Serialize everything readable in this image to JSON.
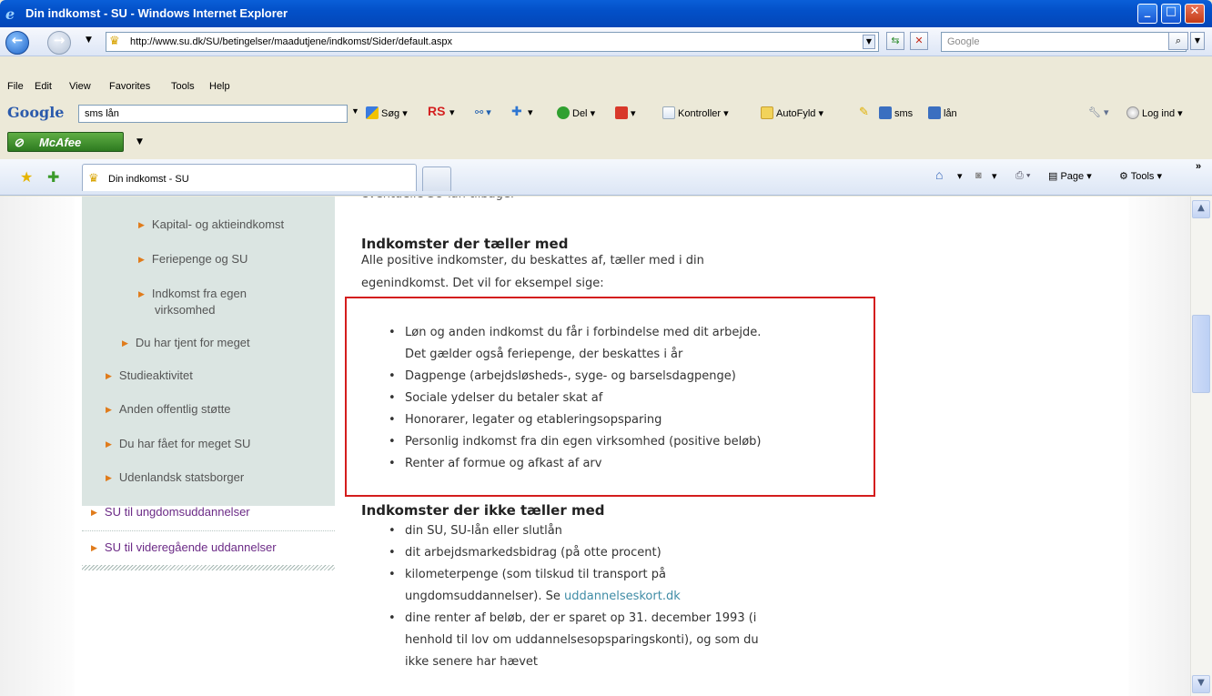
{
  "window": {
    "title": "Din indkomst - SU - Windows Internet Explorer",
    "controls": {
      "minimize": "_",
      "maximize": "□",
      "close": "✕"
    }
  },
  "address_bar": {
    "url": "http://www.su.dk/SU/betingelser/maadutjene/indkomst/Sider/default.aspx",
    "search_placeholder": "Google"
  },
  "menu": [
    "File",
    "Edit",
    "View",
    "Favorites",
    "Tools",
    "Help"
  ],
  "google_toolbar": {
    "logo": "Google",
    "query": "sms lån",
    "items": {
      "sog": "Søg",
      "rs": "RS",
      "del": "Del",
      "kontroller": "Kontroller",
      "autofyld": "AutoFyld",
      "sms": "sms",
      "lan": "lån",
      "log_ind": "Log ind"
    }
  },
  "mcafee": {
    "label": "McAfee"
  },
  "tabs": [
    {
      "label": "Din indkomst - SU"
    }
  ],
  "command_bar": {
    "page": "Page",
    "tools": "Tools"
  },
  "sidebar": {
    "sub_items": [
      "Kapital- og aktieindkomst",
      "Feriepenge og SU",
      "Indkomst fra egen",
      "virksomhed"
    ],
    "items": [
      "Du har tjent for meget",
      "Studieaktivitet",
      "Anden offentlig støtte",
      "Du har fået for meget SU",
      "Udenlandsk statsborger"
    ],
    "top_items": [
      "SU til ungdomsuddannelser",
      "SU til videregående uddannelser"
    ]
  },
  "content": {
    "cut_text": "eventuelle SU-lån tilbage.",
    "section1": {
      "heading": "Indkomster der tæller med",
      "intro_line1": "Alle positive indkomster, du beskattes af, tæller med i din",
      "intro_line2": "egenindkomst. Det vil for eksempel sige:",
      "bullets": [
        "Løn og anden indkomst du får i forbindelse med dit arbejde.",
        "Det gælder også feriepenge, der beskattes i år",
        "Dagpenge (arbejdsløsheds-, syge- og barselsdagpenge)",
        "Sociale ydelser du betaler skat af",
        "Honorarer, legater og etableringsopsparing",
        "Personlig indkomst fra din egen virksomhed (positive beløb)",
        "Renter af formue og afkast af arv"
      ]
    },
    "section2": {
      "heading": "Indkomster der ikke tæller med",
      "bullets": [
        "din SU, SU-lån eller slutlån",
        "dit arbejdsmarkedsbidrag (på otte procent)",
        "kilometerpenge (som tilskud til transport på",
        "ungdomsuddannelser). Se ",
        "uddannelseskort.dk",
        "dine renter af beløb, der er sparet op 31. december 1993 (i",
        "henhold til lov om uddannelsesopsparingskonti), og som du",
        "ikke senere har hævet"
      ]
    }
  }
}
